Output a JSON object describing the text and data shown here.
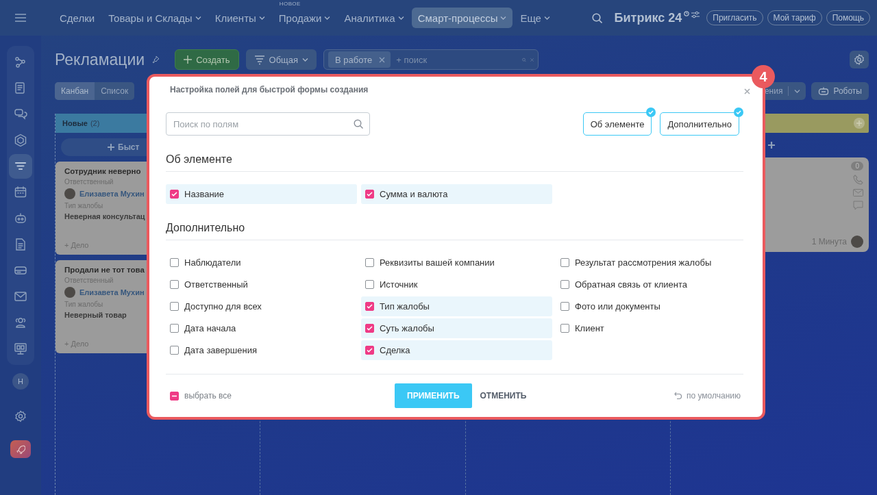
{
  "top_nav": {
    "items": [
      {
        "label": "Сделки",
        "dropdown": false,
        "selected": false
      },
      {
        "label": "Товары и Склады",
        "dropdown": true,
        "selected": false
      },
      {
        "label": "Клиенты",
        "dropdown": true,
        "selected": false
      },
      {
        "label": "Продажи",
        "badge": "НОВОЕ",
        "dropdown": true,
        "selected": false
      },
      {
        "label": "Аналитика",
        "dropdown": true,
        "selected": false
      },
      {
        "label": "Смарт-процессы",
        "dropdown": true,
        "selected": true
      },
      {
        "label": "Еще",
        "dropdown": true,
        "selected": false
      }
    ],
    "logo": "Битрикс",
    "logo_number": "24",
    "buttons": [
      "Пригласить",
      "Мой тариф",
      "Помощь"
    ]
  },
  "sidebar": {
    "items": [
      {
        "kind": "flow",
        "selected": false
      },
      {
        "kind": "news",
        "selected": false
      },
      {
        "kind": "chat",
        "selected": false
      },
      {
        "kind": "hexagon",
        "selected": false
      },
      {
        "kind": "funnel",
        "selected": true
      },
      {
        "kind": "calendar",
        "selected": false
      },
      {
        "kind": "robot",
        "selected": false
      },
      {
        "kind": "document",
        "selected": false
      },
      {
        "kind": "card",
        "selected": false
      },
      {
        "kind": "mail",
        "selected": false
      },
      {
        "kind": "people",
        "selected": false
      },
      {
        "kind": "board",
        "selected": false
      }
    ],
    "avatar": "Н"
  },
  "page": {
    "title": "Рекламации",
    "create_button": "Создать",
    "preset": "Общая",
    "filter": {
      "tag": "В работе",
      "placeholder": "+ поиск"
    },
    "view_tabs": [
      {
        "label": "Канбан",
        "selected": true
      },
      {
        "label": "Список",
        "selected": false
      }
    ],
    "partial_button": "ения",
    "robots_button": "Роботы"
  },
  "kanban": {
    "first_column": {
      "title": "Новые",
      "count": "(2)",
      "quick_add": "Быст",
      "cards": [
        {
          "title": "Сотрудник неверно",
          "responsible_label": "Ответственный",
          "responsible": "Елизавета Мухин",
          "field_label": "Тип жалобы",
          "field_value": "Неверная консультац",
          "add_activity": "+ Дело"
        },
        {
          "title": "Продали не тот това",
          "responsible_label": "Ответственный",
          "responsible": "Елизавета Мухин",
          "field_label": "Тип жалобы",
          "field_value": "Неверный товар",
          "add_activity": "+ Дело"
        }
      ]
    },
    "last_column": {
      "card": {
        "counter": "0",
        "time": "1 Минута"
      }
    }
  },
  "dialog": {
    "step_badge": "4",
    "title": "Настройка полей для быстрой формы создания",
    "search": {
      "placeholder": "Поиск по полям"
    },
    "section_toggles": [
      {
        "label": "Об элементе",
        "checked": true
      },
      {
        "label": "Дополнительно",
        "checked": true
      }
    ],
    "sections": [
      {
        "title": "Об элементе",
        "fields": [
          {
            "label": "Название",
            "checked": true
          },
          {
            "label": "Сумма и валюта",
            "checked": true
          }
        ]
      },
      {
        "title": "Дополнительно",
        "fields": [
          {
            "label": "Наблюдатели",
            "checked": false
          },
          {
            "label": "Ответственный",
            "checked": false
          },
          {
            "label": "Доступно для всех",
            "checked": false
          },
          {
            "label": "Дата начала",
            "checked": false
          },
          {
            "label": "Дата завершения",
            "checked": false
          },
          {
            "label": "Реквизиты вашей компании",
            "checked": false
          },
          {
            "label": "Источник",
            "checked": false
          },
          {
            "label": "Тип жалобы",
            "checked": true
          },
          {
            "label": "Суть жалобы",
            "checked": true
          },
          {
            "label": "Сделка",
            "checked": true
          },
          {
            "label": "Результат рассмотрения жалобы",
            "checked": false
          },
          {
            "label": "Обратная связь от клиента",
            "checked": false
          },
          {
            "label": "Фото или документы",
            "checked": false
          },
          {
            "label": "Клиент",
            "checked": false
          }
        ]
      }
    ],
    "select_all": {
      "label": "выбрать все",
      "indeterminate": true
    },
    "apply": "ПРИМЕНИТЬ",
    "cancel": "ОТМЕНИТЬ",
    "reset": "по умолчанию"
  }
}
